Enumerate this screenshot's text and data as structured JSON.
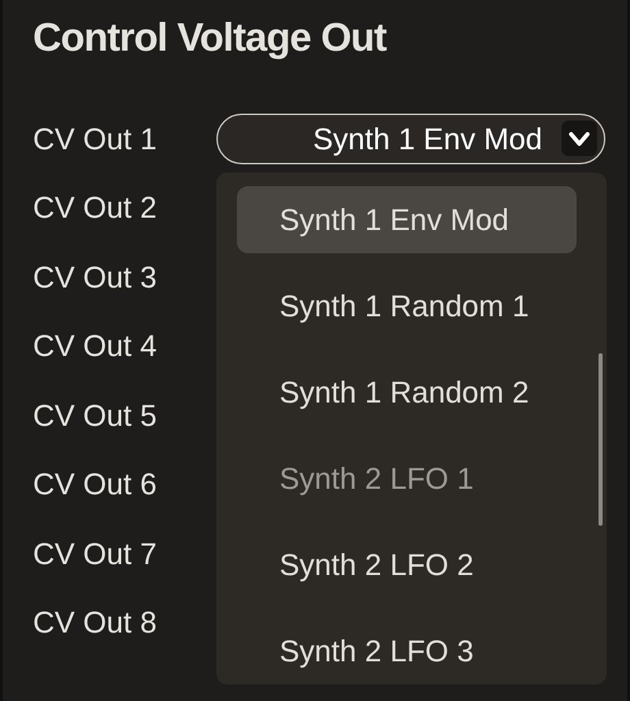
{
  "title": "Control Voltage Out",
  "outputs": [
    {
      "label": "CV Out 1"
    },
    {
      "label": "CV Out 2"
    },
    {
      "label": "CV Out 3"
    },
    {
      "label": "CV Out 4"
    },
    {
      "label": "CV Out 5"
    },
    {
      "label": "CV Out 6"
    },
    {
      "label": "CV Out 7"
    },
    {
      "label": "CV Out 8"
    }
  ],
  "dropdown": {
    "value": "Synth 1 Env Mod",
    "expanded": true
  },
  "menu": [
    {
      "label": "Synth 1 Env Mod",
      "selected": true,
      "disabled": false
    },
    {
      "label": "Synth 1 Random 1",
      "selected": false,
      "disabled": false
    },
    {
      "label": "Synth 1 Random 2",
      "selected": false,
      "disabled": false
    },
    {
      "label": "Synth 2 LFO 1",
      "selected": false,
      "disabled": true
    },
    {
      "label": "Synth 2 LFO 2",
      "selected": false,
      "disabled": false
    },
    {
      "label": "Synth 2 LFO 3",
      "selected": false,
      "disabled": false
    }
  ]
}
